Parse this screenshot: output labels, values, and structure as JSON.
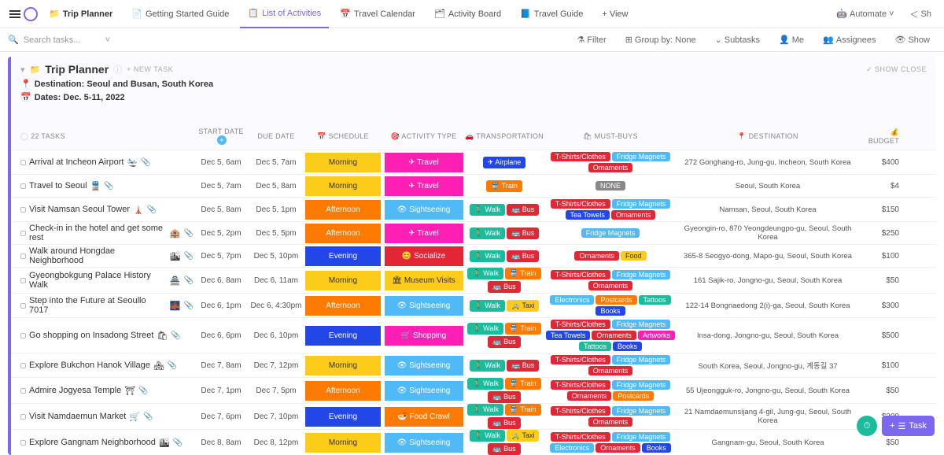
{
  "header": {
    "main_tab": "Trip Planner",
    "tabs": [
      {
        "label": "Getting Started Guide",
        "icon": "📄"
      },
      {
        "label": "List of Activities",
        "icon": "📋",
        "active": true
      },
      {
        "label": "Travel Calendar",
        "icon": "📅"
      },
      {
        "label": "Activity Board",
        "icon": "🗂"
      },
      {
        "label": "Travel Guide",
        "icon": "📘"
      }
    ],
    "view_btn": "+ View",
    "automate": "Automate"
  },
  "toolbar": {
    "search_placeholder": "Search tasks...",
    "filter": "Filter",
    "group": "Group by: None",
    "subtasks": "Subtasks",
    "me": "Me",
    "assignees": "Assignees",
    "show": "Show"
  },
  "list": {
    "title": "Trip Planner",
    "newtask": "+ NEW TASK",
    "showclose": "✓ SHOW CLOSE",
    "destination_label": "Destination: Seoul and Busan, South Korea",
    "dates_label": "Dates: Dec. 5-11, 2022",
    "task_count": "22 TASKS"
  },
  "columns": {
    "start": "START DATE",
    "due": "DUE DATE",
    "sched": "SCHEDULE",
    "act": "ACTIVITY TYPE",
    "trans": "TRANSPORTATION",
    "must": "MUST-BUYS",
    "dest": "DESTINATION",
    "budget": "BUDGET"
  },
  "rows": [
    {
      "name": "Arrival at Incheon Airport",
      "emoji": "🛬",
      "start": "Dec 5, 6am",
      "due": "Dec 5, 7am",
      "sched": "Morning",
      "schedc": "morning",
      "act": "✈ Travel",
      "actc": "travel",
      "trans": [
        {
          "t": "✈ Airplane",
          "c": "airplane"
        }
      ],
      "must": [
        {
          "t": "T-Shirts/Clothes",
          "c": "tshirts"
        },
        {
          "t": "Fridge Magnets",
          "c": "fridgemag"
        },
        {
          "t": "Ornaments",
          "c": "ornaments"
        }
      ],
      "dest": "272 Gonghang-ro, Jung-gu, Incheon, South Korea",
      "budget": "$400"
    },
    {
      "name": "Travel to Seoul",
      "emoji": "🚆",
      "start": "Dec 5, 7am",
      "due": "Dec 5, 8am",
      "sched": "Morning",
      "schedc": "morning",
      "act": "✈ Travel",
      "actc": "travel",
      "trans": [
        {
          "t": "🚆 Train",
          "c": "train"
        }
      ],
      "must": [
        {
          "t": "NONE",
          "c": "nonepill"
        }
      ],
      "dest": "Seoul, South Korea",
      "budget": "$4"
    },
    {
      "name": "Visit Namsan Seoul Tower",
      "emoji": "🗼",
      "start": "Dec 5, 8am",
      "due": "Dec 5, 1pm",
      "sched": "Afternoon",
      "schedc": "afternoon",
      "act": "👁 Sightseeing",
      "actc": "sight",
      "trans": [
        {
          "t": "🚶 Walk",
          "c": "walk"
        },
        {
          "t": "🚌 Bus",
          "c": "bus"
        }
      ],
      "must": [
        {
          "t": "T-Shirts/Clothes",
          "c": "tshirts"
        },
        {
          "t": "Fridge Magnets",
          "c": "fridgemag"
        },
        {
          "t": "Tea Towels",
          "c": "teatowels"
        },
        {
          "t": "Ornaments",
          "c": "ornaments"
        }
      ],
      "dest": "Namsan, Seoul, South Korea",
      "budget": "$150"
    },
    {
      "name": "Check-in in the hotel and get some rest",
      "emoji": "🏨",
      "start": "Dec 5, 2pm",
      "due": "Dec 5, 5pm",
      "sched": "Afternoon",
      "schedc": "afternoon",
      "act": "✈ Travel",
      "actc": "travel",
      "trans": [
        {
          "t": "🚶 Walk",
          "c": "walk"
        },
        {
          "t": "🚌 Bus",
          "c": "bus"
        }
      ],
      "must": [
        {
          "t": "Fridge Magnets",
          "c": "fridgemag"
        }
      ],
      "dest": "Gyeongin-ro, 870 Yeongdeungpo-gu, Seoul, South Korea",
      "budget": "$250"
    },
    {
      "name": "Walk around Hongdae Neighborhood",
      "emoji": "🏙",
      "start": "Dec 5, 7pm",
      "due": "Dec 5, 10pm",
      "sched": "Evening",
      "schedc": "evening",
      "act": "😊 Socialize",
      "actc": "socialize",
      "trans": [
        {
          "t": "🚶 Walk",
          "c": "walk"
        },
        {
          "t": "🚌 Bus",
          "c": "bus"
        }
      ],
      "must": [
        {
          "t": "Ornaments",
          "c": "ornaments"
        },
        {
          "t": "Food",
          "c": "food"
        }
      ],
      "dest": "365-8 Seogyo-dong, Mapo-gu, Seoul, South Korea",
      "budget": "$100"
    },
    {
      "name": "Gyeongbokgung Palace History Walk",
      "emoji": "🏯",
      "start": "Dec 6, 8am",
      "due": "Dec 6, 11am",
      "sched": "Morning",
      "schedc": "morning",
      "act": "🏛 Museum Visits",
      "actc": "museum",
      "trans": [
        {
          "t": "🚶 Walk",
          "c": "walk"
        },
        {
          "t": "🚆 Train",
          "c": "train"
        },
        {
          "t": "🚌 Bus",
          "c": "bus"
        }
      ],
      "must": [
        {
          "t": "T-Shirts/Clothes",
          "c": "tshirts"
        },
        {
          "t": "Fridge Magnets",
          "c": "fridgemag"
        },
        {
          "t": "Ornaments",
          "c": "ornaments"
        }
      ],
      "dest": "161 Sajik-ro, Jongno-gu, Seoul, South Korea",
      "budget": "$50"
    },
    {
      "name": "Step into the Future at Seoullo 7017",
      "emoji": "🌉",
      "start": "Dec 6, 1pm",
      "due": "Dec 6, 4:30pm",
      "sched": "Afternoon",
      "schedc": "afternoon",
      "act": "👁 Sightseeing",
      "actc": "sight",
      "trans": [
        {
          "t": "🚶 Walk",
          "c": "walk"
        },
        {
          "t": "🚕 Taxi",
          "c": "taxi"
        }
      ],
      "must": [
        {
          "t": "Electronics",
          "c": "electronics"
        },
        {
          "t": "Postcards",
          "c": "postcards"
        },
        {
          "t": "Tattoos",
          "c": "tattoos"
        },
        {
          "t": "Books",
          "c": "books"
        }
      ],
      "dest": "122-14 Bongnaedong 2(i)-ga, Seoul, South Korea",
      "budget": "$300"
    },
    {
      "name": "Go shopping on Insadong Street",
      "emoji": "🛍",
      "start": "Dec 6, 6pm",
      "due": "Dec 6, 10pm",
      "sched": "Evening",
      "schedc": "evening",
      "act": "🛒 Shopping",
      "actc": "shopping",
      "trans": [
        {
          "t": "🚶 Walk",
          "c": "walk"
        },
        {
          "t": "🚆 Train",
          "c": "train"
        },
        {
          "t": "🚌 Bus",
          "c": "bus"
        }
      ],
      "must": [
        {
          "t": "T-Shirts/Clothes",
          "c": "tshirts"
        },
        {
          "t": "Fridge Magnets",
          "c": "fridgemag"
        },
        {
          "t": "Tea Towels",
          "c": "teatowels"
        },
        {
          "t": "Ornaments",
          "c": "ornaments"
        },
        {
          "t": "Artworks",
          "c": "artworks"
        },
        {
          "t": "Tattoos",
          "c": "tattoos"
        },
        {
          "t": "Books",
          "c": "books"
        }
      ],
      "dest": "Insa-dong, Jongno-gu, Seoul, South Korea",
      "budget": "$500"
    },
    {
      "name": "Explore Bukchon Hanok Village",
      "emoji": "🏘",
      "start": "Dec 7, 8am",
      "due": "Dec 7, 12pm",
      "sched": "Morning",
      "schedc": "morning",
      "act": "👁 Sightseeing",
      "actc": "sight",
      "trans": [
        {
          "t": "🚶 Walk",
          "c": "walk"
        },
        {
          "t": "🚌 Bus",
          "c": "bus"
        }
      ],
      "must": [
        {
          "t": "T-Shirts/Clothes",
          "c": "tshirts"
        },
        {
          "t": "Fridge Magnets",
          "c": "fridgemag"
        },
        {
          "t": "Ornaments",
          "c": "ornaments"
        }
      ],
      "dest": "South Korea, Seoul, Jongno-gu, 계동길 37",
      "budget": "$100"
    },
    {
      "name": "Admire Jogyesa Temple",
      "emoji": "⛩",
      "start": "Dec 7, 1pm",
      "due": "Dec 7, 5pm",
      "sched": "Afternoon",
      "schedc": "afternoon",
      "act": "👁 Sightseeing",
      "actc": "sight",
      "trans": [
        {
          "t": "🚶 Walk",
          "c": "walk"
        },
        {
          "t": "🚆 Train",
          "c": "train"
        },
        {
          "t": "🚌 Bus",
          "c": "bus"
        }
      ],
      "must": [
        {
          "t": "T-Shirts/Clothes",
          "c": "tshirts"
        },
        {
          "t": "Fridge Magnets",
          "c": "fridgemag"
        },
        {
          "t": "Ornaments",
          "c": "ornaments"
        },
        {
          "t": "Postcards",
          "c": "postcards"
        }
      ],
      "dest": "55 Ujeongguk-ro, Jongno-gu, Seoul, South Korea",
      "budget": "$50"
    },
    {
      "name": "Visit Namdaemun Market",
      "emoji": "🛒",
      "start": "Dec 7, 6pm",
      "due": "Dec 7, 10pm",
      "sched": "Evening",
      "schedc": "evening",
      "act": "🍜 Food Crawl",
      "actc": "foodcrawl",
      "trans": [
        {
          "t": "🚶 Walk",
          "c": "walk"
        },
        {
          "t": "🚆 Train",
          "c": "train"
        },
        {
          "t": "🚌 Bus",
          "c": "bus"
        }
      ],
      "must": [
        {
          "t": "T-Shirts/Clothes",
          "c": "tshirts"
        },
        {
          "t": "Fridge Magnets",
          "c": "fridgemag"
        },
        {
          "t": "Ornaments",
          "c": "ornaments"
        }
      ],
      "dest": "21 Namdaemunsijang 4-gil, Jung-gu, Seoul, South Korea",
      "budget": "$200"
    },
    {
      "name": "Explore Gangnam Neighborhood",
      "emoji": "🏙",
      "start": "Dec 8, 8am",
      "due": "Dec 8, 12pm",
      "sched": "Morning",
      "schedc": "morning",
      "act": "👁 Sightseeing",
      "actc": "sight",
      "trans": [
        {
          "t": "🚶 Walk",
          "c": "walk"
        },
        {
          "t": "🚕 Taxi",
          "c": "taxi"
        },
        {
          "t": "🚌 Bus",
          "c": "bus"
        }
      ],
      "must": [
        {
          "t": "T-Shirts/Clothes",
          "c": "tshirts"
        },
        {
          "t": "Fridge Magnets",
          "c": "fridgemag"
        },
        {
          "t": "Electronics",
          "c": "electronics"
        },
        {
          "t": "Ornaments",
          "c": "ornaments"
        },
        {
          "t": "Books",
          "c": "books"
        }
      ],
      "dest": "Gangnam-gu, Seoul, South Korea",
      "budget": "$50"
    }
  ],
  "fab": {
    "task": "Task"
  }
}
